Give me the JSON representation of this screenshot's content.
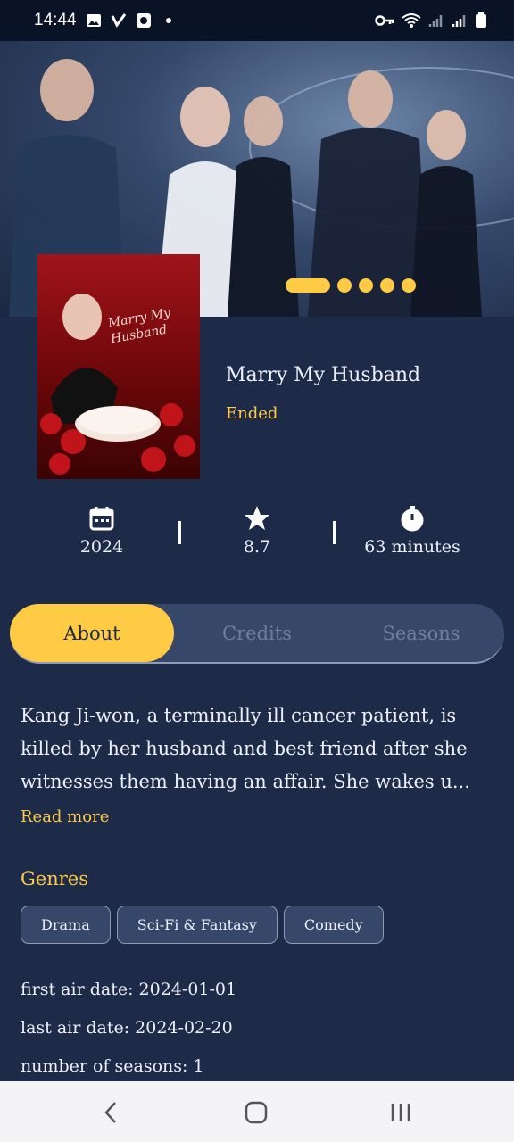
{
  "status_bar": {
    "time": "14:44",
    "left_icons": [
      "gallery-icon",
      "check-icon",
      "screen-record-icon",
      "dot-icon"
    ],
    "right_icons": [
      "key-icon",
      "wifi-icon",
      "signal-icon",
      "signal-icon",
      "battery-icon"
    ]
  },
  "banner": {
    "carousel_dots": 5,
    "active_index": 0
  },
  "show": {
    "poster_title": "Marry My Husband",
    "title": "Marry My Husband",
    "status": "Ended"
  },
  "stats": {
    "year": "2024",
    "rating": "8.7",
    "runtime": "63 minutes"
  },
  "tabs": [
    "About",
    "Credits",
    "Seasons"
  ],
  "active_tab": "About",
  "overview": "Kang Ji-won, a terminally ill cancer patient, is killed by her husband and best friend after she witnesses them having an affair. She wakes u...",
  "read_more": "Read more",
  "genres_title": "Genres",
  "genres": [
    "Drama",
    "Sci-Fi & Fantasy",
    "Comedy"
  ],
  "facts": {
    "first_air_date": "first air date: 2024-01-01",
    "last_air_date": "last air date: 2024-02-20",
    "number_of_seasons": "number of seasons:  1"
  },
  "colors": {
    "background": "#1d2a48",
    "accent": "#ffcb45",
    "surface": "#36476a"
  }
}
